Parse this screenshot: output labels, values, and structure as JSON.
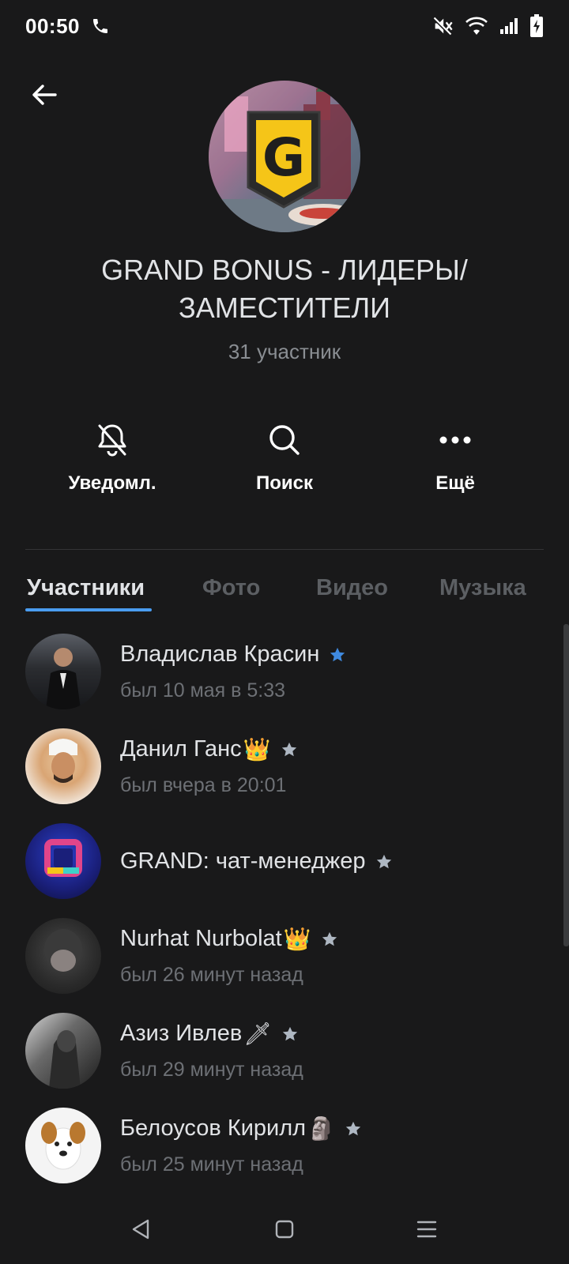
{
  "status_bar": {
    "time": "00:50",
    "icons": [
      "phone-icon",
      "mute-icon",
      "wifi-icon",
      "signal-icon",
      "battery-charging-icon"
    ]
  },
  "header": {
    "back_icon": "arrow-left-icon",
    "avatar_icon": "group-avatar-logo",
    "avatar_letter": "G",
    "title": "GRAND BONUS - ЛИДЕРЫ/ ЗАМЕСТИТЕЛИ",
    "subtitle": "31 участник"
  },
  "actions": [
    {
      "label": "Уведомл.",
      "icon": "bell-off-icon"
    },
    {
      "label": "Поиск",
      "icon": "search-icon"
    },
    {
      "label": "Ещё",
      "icon": "more-dots-icon"
    }
  ],
  "tabs": [
    {
      "label": "Участники",
      "active": true
    },
    {
      "label": "Фото",
      "active": false
    },
    {
      "label": "Видео",
      "active": false
    },
    {
      "label": "Музыка",
      "active": false
    }
  ],
  "members": [
    {
      "name": "Владислав Красин",
      "emoji": "",
      "status": "был 10 мая в 5:33",
      "star": "blue"
    },
    {
      "name": "Данил Ганс",
      "emoji": "👑",
      "status": "был вчера в 20:01",
      "star": "gray"
    },
    {
      "name": "GRAND: чат-менеджер",
      "emoji": "",
      "status": "",
      "star": "gray"
    },
    {
      "name": "Nurhat Nurbolat",
      "emoji": "👑",
      "status": "был 26 минут назад",
      "star": "gray"
    },
    {
      "name": "Азиз Ивлев",
      "emoji": "🗡",
      "status": "был 29 минут назад",
      "star": "gray"
    },
    {
      "name": "Белоусов Кирилл",
      "emoji": "🗿",
      "status": "был 25 минут назад",
      "star": "gray"
    }
  ],
  "nav": {
    "icons": [
      "nav-back-icon",
      "nav-home-icon",
      "nav-menu-icon"
    ]
  },
  "colors": {
    "background": "#19191a",
    "accent": "#4a9cf0",
    "text_primary": "#e1e3e6",
    "text_secondary": "#6d7075",
    "logo_yellow": "#f5c518"
  }
}
